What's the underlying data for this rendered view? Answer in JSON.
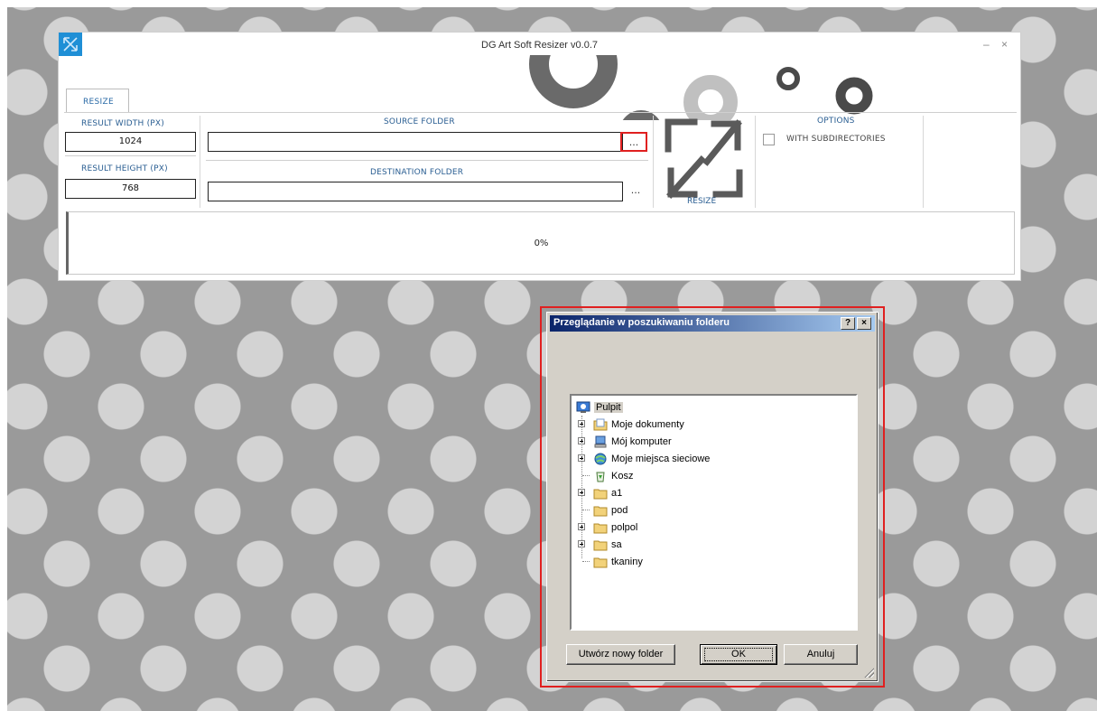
{
  "app": {
    "title": "DG Art Soft Resizer v0.0.7",
    "minimize": "–",
    "close": "×",
    "tab_resize": "RESIZE",
    "result_width_label": "RESULT WIDTH (PX)",
    "result_width_value": "1024",
    "result_height_label": "RESULT HEIGHT (PX)",
    "result_height_value": "768",
    "source_folder_label": "SOURCE FOLDER",
    "source_folder_value": "",
    "destination_folder_label": "DESTINATION FOLDER",
    "destination_folder_value": "",
    "browse_label": "...",
    "resize_label": "RESIZE",
    "options_label": "OPTIONS",
    "with_subdirectories_label": "WITH SUBDIRECTORIES",
    "with_subdirectories_checked": false,
    "progress_text": "0%",
    "accent_color": "#2a5e92",
    "icon_color": "#1f8fd6"
  },
  "dialog": {
    "title": "Przeglądanie w poszukiwaniu folderu",
    "help_button": "?",
    "close_button": "×",
    "tree": [
      {
        "label": "Pulpit",
        "icon": "desktop-icon",
        "selected": true,
        "expandable": false
      },
      {
        "label": "Moje dokumenty",
        "icon": "documents-folder-icon",
        "expandable": true
      },
      {
        "label": "Mój komputer",
        "icon": "computer-icon",
        "expandable": true
      },
      {
        "label": "Moje miejsca sieciowe",
        "icon": "network-places-icon",
        "expandable": true
      },
      {
        "label": "Kosz",
        "icon": "recycle-bin-icon",
        "expandable": false
      },
      {
        "label": "a1",
        "icon": "folder-icon",
        "expandable": true
      },
      {
        "label": "pod",
        "icon": "folder-icon",
        "expandable": false
      },
      {
        "label": "polpol",
        "icon": "folder-icon",
        "expandable": true
      },
      {
        "label": "sa",
        "icon": "folder-icon",
        "expandable": true
      },
      {
        "label": "tkaniny",
        "icon": "folder-icon",
        "expandable": false
      }
    ],
    "new_folder_button": "Utwórz nowy folder",
    "ok_button": "OK",
    "cancel_button": "Anuluj",
    "title_bar_color": "#0a246a"
  }
}
